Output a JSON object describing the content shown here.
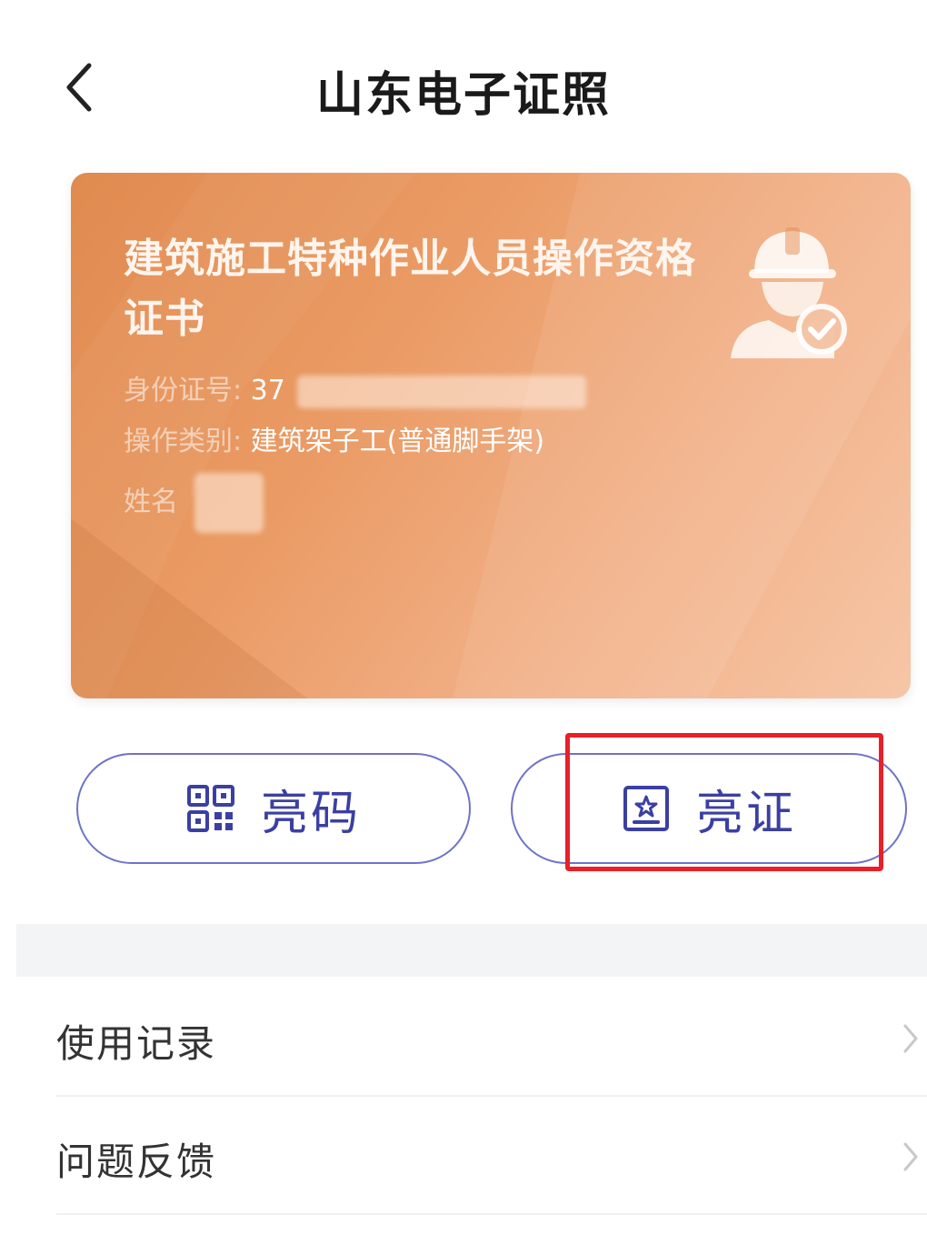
{
  "header": {
    "title": "山东电子证照",
    "back_icon": "chevron-left-icon"
  },
  "card": {
    "title": "建筑施工特种作业人员操作资格证书",
    "fields": {
      "id_label": "身份证号:",
      "id_value": "37",
      "type_label": "操作类别:",
      "type_value": "建筑架子工(普通脚手架)",
      "name_label": "姓名"
    },
    "icon": "worker-verified-icon",
    "colors": {
      "gradient_start": "#e08a4f",
      "gradient_end": "#f6c6a6"
    }
  },
  "actions": {
    "show_code_label": "亮码",
    "show_code_icon": "qr-code-icon",
    "show_cert_label": "亮证",
    "show_cert_icon": "certificate-icon",
    "accent_color": "#3b3fa3",
    "highlight_color": "#e8202a"
  },
  "menu": {
    "items": [
      {
        "label": "使用记录",
        "icon": "chevron-right-icon"
      },
      {
        "label": "问题反馈",
        "icon": "chevron-right-icon"
      }
    ]
  }
}
